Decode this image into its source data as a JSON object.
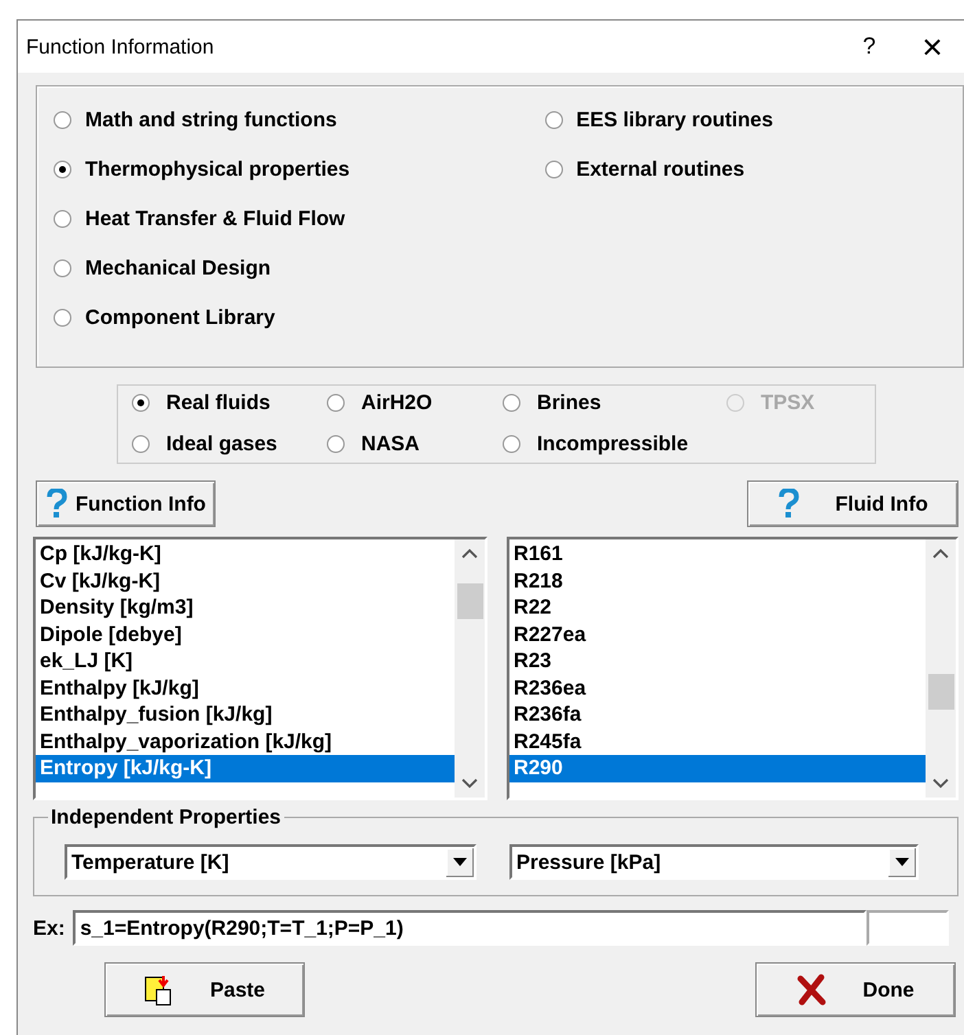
{
  "window": {
    "title": "Function Information",
    "help_button": "?",
    "close_button": "×"
  },
  "categories": {
    "columns": [
      [
        {
          "label": "Math and string functions",
          "selected": false
        },
        {
          "label": "Thermophysical properties",
          "selected": true
        },
        {
          "label": "Heat Transfer & Fluid Flow",
          "selected": false
        },
        {
          "label": "Mechanical Design",
          "selected": false
        },
        {
          "label": "Component Library",
          "selected": false
        }
      ],
      [
        {
          "label": "EES library routines",
          "selected": false
        },
        {
          "label": "External routines",
          "selected": false
        }
      ]
    ]
  },
  "fluid_types": {
    "rows": [
      [
        {
          "label": "Real fluids",
          "selected": true,
          "disabled": false
        },
        {
          "label": "AirH2O",
          "selected": false,
          "disabled": false
        },
        {
          "label": "Brines",
          "selected": false,
          "disabled": false
        },
        {
          "label": "TPSX",
          "selected": false,
          "disabled": true
        }
      ],
      [
        {
          "label": "Ideal gases",
          "selected": false,
          "disabled": false
        },
        {
          "label": "NASA",
          "selected": false,
          "disabled": false
        },
        {
          "label": "Incompressible",
          "selected": false,
          "disabled": false
        }
      ]
    ]
  },
  "function_info_button": "Function Info",
  "fluid_info_button": "Fluid Info",
  "functions_list": {
    "items": [
      {
        "text": "Cp [kJ/kg-K]",
        "selected": false
      },
      {
        "text": "Cv [kJ/kg-K]",
        "selected": false
      },
      {
        "text": "Density [kg/m3]",
        "selected": false
      },
      {
        "text": "Dipole [debye]",
        "selected": false
      },
      {
        "text": "ek_LJ [K]",
        "selected": false
      },
      {
        "text": "Enthalpy [kJ/kg]",
        "selected": false
      },
      {
        "text": "Enthalpy_fusion [kJ/kg]",
        "selected": false
      },
      {
        "text": "Enthalpy_vaporization [kJ/kg]",
        "selected": false
      },
      {
        "text": "Entropy [kJ/kg-K]",
        "selected": true
      }
    ]
  },
  "fluids_list": {
    "items": [
      {
        "text": "R161",
        "selected": false
      },
      {
        "text": "R218",
        "selected": false
      },
      {
        "text": "R22",
        "selected": false
      },
      {
        "text": "R227ea",
        "selected": false
      },
      {
        "text": "R23",
        "selected": false
      },
      {
        "text": "R236ea",
        "selected": false
      },
      {
        "text": "R236fa",
        "selected": false
      },
      {
        "text": "R245fa",
        "selected": false
      },
      {
        "text": "R290",
        "selected": true
      }
    ]
  },
  "independent_properties": {
    "title": "Independent Properties",
    "first": "Temperature [K]",
    "second": "Pressure [kPa]"
  },
  "example": {
    "label": "Ex:",
    "value": "s_1=Entropy(R290;T=T_1;P=P_1)"
  },
  "paste_button": "Paste",
  "done_button": "Done"
}
